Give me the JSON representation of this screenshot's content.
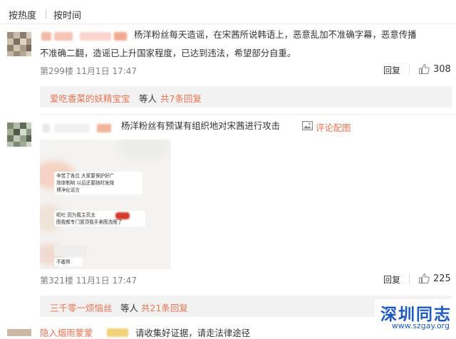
{
  "sort": {
    "hot": "按热度",
    "time": "按时间"
  },
  "comments": [
    {
      "text": "杨洋粉丝每天造谣，在宋茜所说韩语上，恶意乱加不准确字幕，恶意传播不准确二翻，造谣已上升国家程度，已达到违法，希望部分自重。",
      "text_line1": "杨洋粉丝每天造谣，在宋茜所说韩语上，恶意乱加不准确字幕，恶意传播",
      "text_line2": "不准确二翻，造谣已上升国家程度，已达到违法，希望部分自重。",
      "floor_time": "第299楼 11月1日 17:47",
      "reply": "回复",
      "likes": "308",
      "sub": {
        "user": "爱吃香菜的妖精宝宝",
        "etc": "等人",
        "total": "共7条回复"
      }
    },
    {
      "text": "杨洋粉丝有预谋有组织地对宋茜进行攻击",
      "pic_link": "评论配图",
      "photo_lines": [
        "辛苦了各位 大家要保护好广",
        "场体制呐 以后还要随时发微",
        "博净化谣言",
        "呃吐 因为我主页太",
        "图我都专门置顶我手美图洗眼了",
        "不敢熬"
      ],
      "floor_time": "第321楼 11月1日 17:47",
      "reply": "回复",
      "likes": "225",
      "sub": {
        "user": "三千零一烦恼丝",
        "etc": "等人",
        "total": "共21条回复"
      }
    }
  ],
  "third": {
    "nick": "隐入烟雨蒙蒙",
    "text": "请收集好证据，请走法律途径"
  },
  "watermark": {
    "name": "深圳同志",
    "url": "www.szgay.org"
  },
  "colors": {
    "link": "#eb7350",
    "meta": "#808080",
    "subbox": "#f2f2f2",
    "logo": "#1b59c5"
  }
}
